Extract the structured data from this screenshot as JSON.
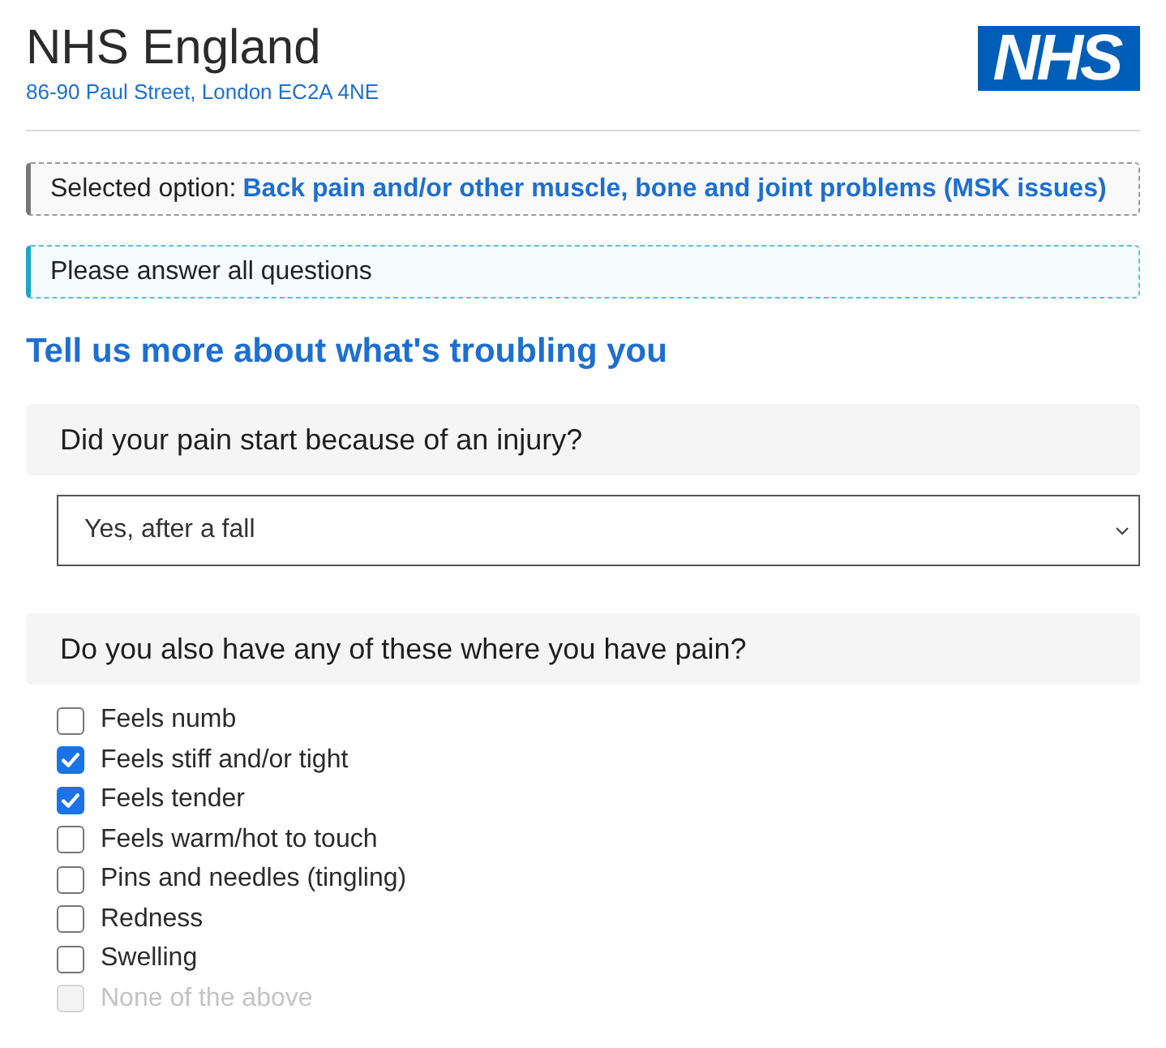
{
  "header": {
    "title": "NHS England",
    "address": "86-90 Paul Street, London EC2A 4NE",
    "logo": "NHS"
  },
  "selected_option": {
    "label": "Selected option:",
    "value": "Back pain and/or other muscle, bone and joint problems (MSK issues)"
  },
  "notice": "Please answer all questions",
  "heading": "Tell us more about what's troubling you",
  "questions": [
    {
      "kind": "select",
      "prompt": "Did your pain start because of an injury?",
      "value": "Yes, after a fall"
    },
    {
      "kind": "checkboxes",
      "prompt": "Do you also have any of these where you have pain?",
      "options": [
        {
          "label": "Feels numb",
          "checked": false,
          "disabled": false
        },
        {
          "label": "Feels stiff and/or tight",
          "checked": true,
          "disabled": false
        },
        {
          "label": "Feels tender",
          "checked": true,
          "disabled": false
        },
        {
          "label": "Feels warm/hot to touch",
          "checked": false,
          "disabled": false
        },
        {
          "label": "Pins and needles (tingling)",
          "checked": false,
          "disabled": false
        },
        {
          "label": "Redness",
          "checked": false,
          "disabled": false
        },
        {
          "label": "Swelling",
          "checked": false,
          "disabled": false
        },
        {
          "label": "None of the above",
          "checked": false,
          "disabled": true
        }
      ]
    }
  ]
}
